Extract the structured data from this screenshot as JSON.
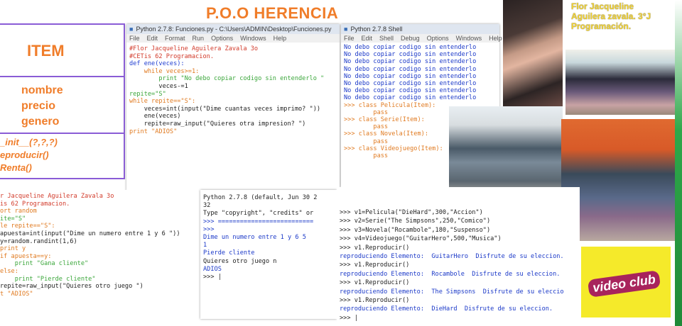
{
  "title": "P.O.O HERENCIA",
  "uml": {
    "class_name": "ITEM",
    "attributes": [
      "nombre",
      "precio",
      "genero"
    ],
    "methods": [
      "_init__(?,?,?)",
      "eproducir()",
      "Renta()"
    ]
  },
  "editor": {
    "window_title": "Python 2.7.8: Funciones.py - C:\\Users\\ADMIN\\Desktop\\Funciones.py",
    "menu": [
      "File",
      "Edit",
      "Format",
      "Run",
      "Options",
      "Windows",
      "Help"
    ],
    "lines": [
      "#Flor Jacqueline Aguilera Zavala 3o",
      "#CETis 62 Programacion.",
      "",
      "def ene(veces):",
      "    while veces>=1:",
      "        print \"No debo copiar codigo sin entenderlo \"",
      "        veces-=1",
      "repite=\"S\"",
      "while repite==\"S\":",
      "    veces=int(input(\"Dime cuantas veces imprimo? \"))",
      "    ene(veces)",
      "    repite=raw_input(\"Quieres otra impresion? \")",
      "print \"ADIOS\""
    ]
  },
  "shell": {
    "window_title": "Python 2.7.8 Shell",
    "menu": [
      "File",
      "Edit",
      "Shell",
      "Debug",
      "Options",
      "Windows",
      "Help"
    ],
    "output_lines": [
      "No debo copiar codigo sin entenderlo",
      "No debo copiar codigo sin entenderlo",
      "No debo copiar codigo sin entenderlo",
      "No debo copiar codigo sin entenderlo",
      "No debo copiar codigo sin entenderlo",
      "No debo copiar codigo sin entenderlo",
      "No debo copiar codigo sin entenderlo",
      "No debo copiar codigo sin entenderlo"
    ],
    "class_lines": [
      ">>> class Pelicula(Item):",
      "        pass",
      "",
      ">>> class Serie(Item):",
      "        pass",
      "",
      ">>> class Novela(Item):",
      "        pass",
      "",
      ">>> class Videojuego(Item):",
      "        pass"
    ]
  },
  "credits": [
    "Flor Jacqueline",
    "Aguilera zavala. 3°J",
    "Programación."
  ],
  "shell2": {
    "lines": [
      "Python 2.7.8 (default, Jun 30 2",
      "32",
      "Type \"copyright\", \"credits\" or",
      ">>> ==========================",
      ">>>",
      "Dime un numero entre 1 y 6 5",
      "1",
      "Pierde cliente",
      "Quieres otro juego n",
      "ADIOS",
      ">>> |"
    ]
  },
  "code_bl": {
    "lines": [
      "r Jacqueline Aguilera Zavala 3o",
      "is 62 Programacion.",
      "",
      "ort random",
      "ite=\"S\"",
      "le repite==\"S\":",
      "apuesta=int(input(\"Dime un numero entre 1 y 6 \"))",
      "y=random.randint(1,6)",
      "print y",
      "if apuesta==y:",
      "    print \"Gana cliente\"",
      "else:",
      "    print \"Pierde cliente\"",
      "repite=raw_input(\"Quieres otro juego \")",
      "t \"ADIOS\""
    ]
  },
  "code_br": {
    "lines": [
      ">>> v1=Pelicula(\"DieHard\",300,\"Accion\")",
      ">>> v2=Serie(\"The Simpsons\",250,\"Comico\")",
      ">>> v3=Novela(\"Rocambole\",180,\"Suspenso\")",
      ">>> v4=Videojuego(\"GuitarHero\",500,\"Musica\")",
      ">>> v1.Reproducir()",
      "reproduciendo Elemento:  GuitarHero  Disfrute de su eleccion.",
      ">>> v1.Reproducir()",
      "reproduciendo Elemento:  Rocambole  Disfrute de su eleccion.",
      ">>> v1.Reproducir()",
      "reproduciendo Elemento:  The Simpsons  Disfrute de su eleccio",
      ">>> v1.Reproducir()",
      "reproduciendo Elemento:  DieHard  Disfrute de su eleccion.",
      ">>> |"
    ]
  },
  "logo_text": "video club"
}
